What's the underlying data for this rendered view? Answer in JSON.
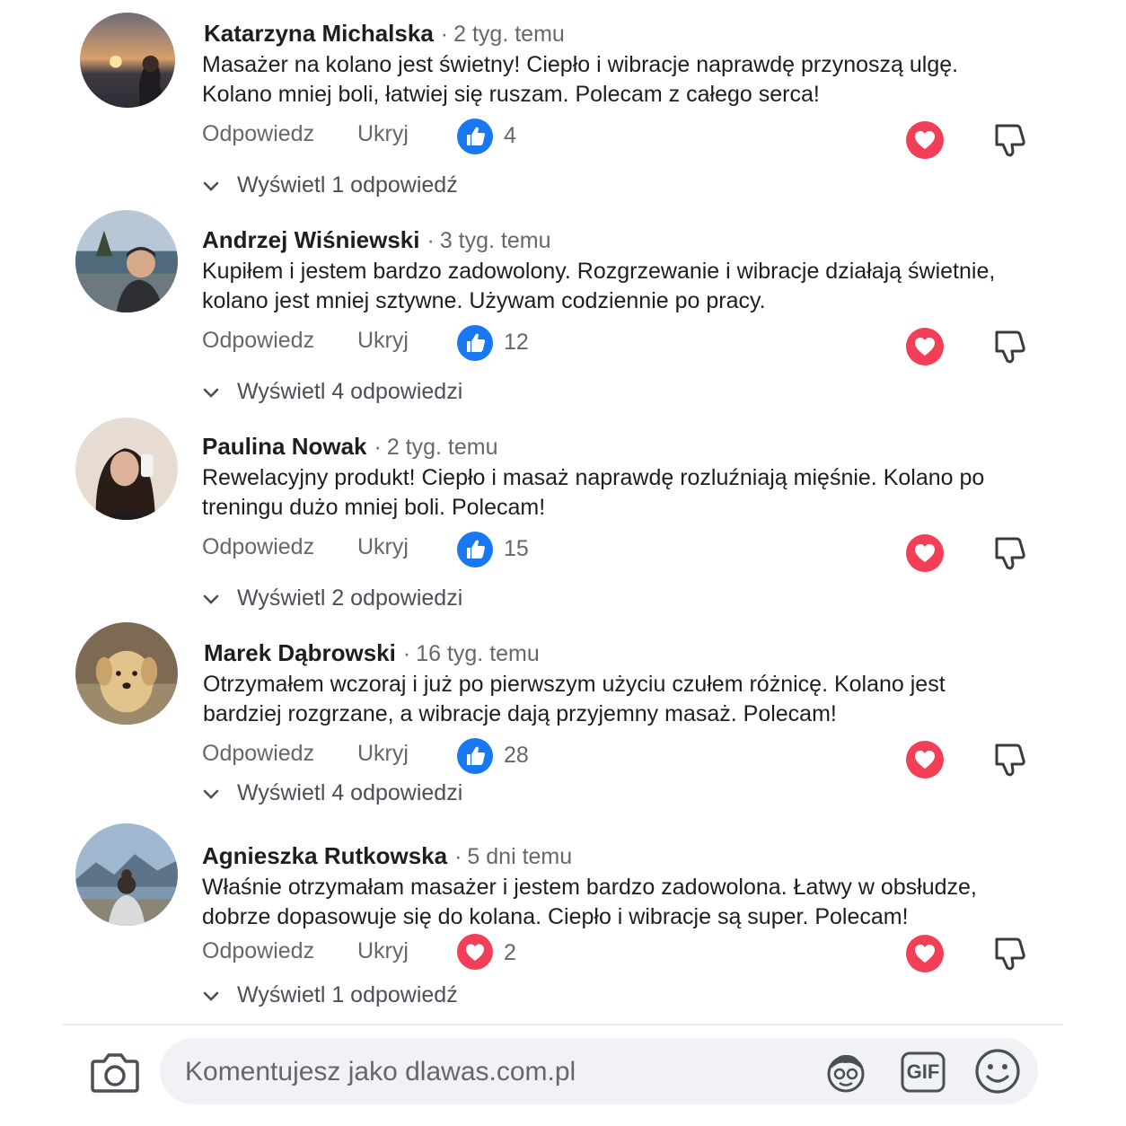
{
  "comments": [
    {
      "author": "Katarzyna Michalska",
      "time": "2 tyg. temu",
      "text_line1": "Masażer na kolano jest świetny! Ciepło i wibracje naprawdę przynoszą ulgę.",
      "text_line2": "Kolano mniej boli, łatwiej się ruszam. Polecam z całego serca!",
      "reply_label": "Odpowiedz",
      "hide_label": "Ukryj",
      "reaction_icon": "like-icon",
      "reaction_count": "4",
      "view_replies": "Wyświetl 1 odpowiedź"
    },
    {
      "author": "Andrzej Wiśniewski",
      "time": "3 tyg. temu",
      "text_line1": "Kupiłem i jestem bardzo zadowolony. Rozgrzewanie i wibracje działają świetnie,",
      "text_line2": "kolano jest mniej sztywne. Używam codziennie po pracy.",
      "reply_label": "Odpowiedz",
      "hide_label": "Ukryj",
      "reaction_icon": "like-icon",
      "reaction_count": "12",
      "view_replies": "Wyświetl 4 odpowiedzi"
    },
    {
      "author": "Paulina Nowak",
      "time": "2 tyg. temu",
      "text_line1": "Rewelacyjny produkt! Ciepło i masaż naprawdę rozluźniają mięśnie. Kolano po",
      "text_line2": "treningu dużo mniej boli. Polecam!",
      "reply_label": "Odpowiedz",
      "hide_label": "Ukryj",
      "reaction_icon": "like-icon",
      "reaction_count": "15",
      "view_replies": "Wyświetl 2 odpowiedzi"
    },
    {
      "author": "Marek Dąbrowski",
      "time": "16 tyg. temu",
      "text_line1": "Otrzymałem wczoraj i już po pierwszym użyciu czułem różnicę. Kolano jest",
      "text_line2": "bardziej rozgrzane, a wibracje dają przyjemny masaż. Polecam!",
      "reply_label": "Odpowiedz",
      "hide_label": "Ukryj",
      "reaction_icon": "like-icon",
      "reaction_count": "28",
      "view_replies": "Wyświetl 4 odpowiedzi"
    },
    {
      "author": "Agnieszka Rutkowska",
      "time": "5 dni temu",
      "text_line1": "Właśnie otrzymałam masażer i jestem bardzo zadowolona. Łatwy w obsłudze,",
      "text_line2": "dobrze dopasowuje się do kolana. Ciepło i wibracje są super. Polecam!",
      "reply_label": "Odpowiedz",
      "hide_label": "Ukryj",
      "reaction_icon": "love-icon",
      "reaction_count": "2",
      "view_replies": "Wyświetl 1 odpowiedź"
    }
  ],
  "composer": {
    "placeholder": "Komentujesz jako dlawas.com.pl",
    "camera_icon": "camera-icon",
    "avatar_icon": "avatar-sticker-icon",
    "gif_label": "GIF",
    "emoji_icon": "emoji-icon"
  },
  "colors": {
    "like_blue": "#1877f2",
    "love_red": "#f33e58",
    "secondary_text": "#65676b",
    "input_bg": "#f0f2f5"
  }
}
